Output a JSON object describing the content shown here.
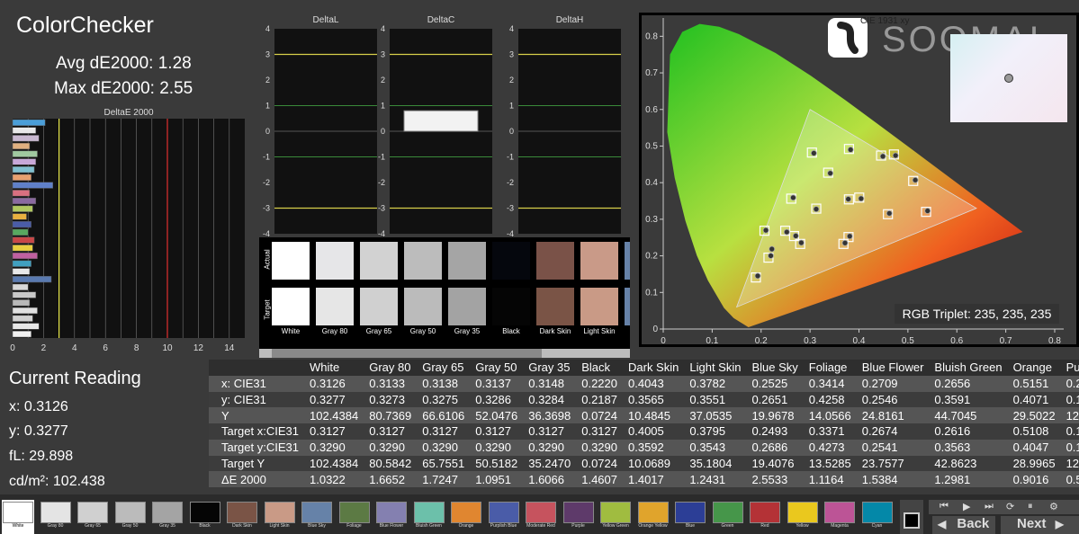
{
  "app": {
    "title": "ColorChecker",
    "avg_label": "Avg dE2000: 1.28",
    "max_label": "Max dE2000: 2.55",
    "watermark": "SOOMAL"
  },
  "deltae_chart": {
    "title": "DeltaE 2000",
    "ticks": [
      "0",
      "2",
      "4",
      "6",
      "8",
      "10",
      "12",
      "14"
    ],
    "xlim": [
      0,
      15
    ],
    "thresholds": [
      {
        "value": 3,
        "color": "#e6e64a"
      },
      {
        "value": 10,
        "color": "#e03030"
      }
    ],
    "values": [
      2.1,
      1.5,
      1.7,
      1.1,
      1.6,
      1.5,
      1.4,
      1.2,
      2.6,
      1.1,
      1.5,
      1.3,
      0.9,
      1.2,
      1.0,
      1.4,
      1.3,
      1.6,
      1.2,
      1.1,
      2.5,
      1.0,
      1.5,
      1.1,
      1.6,
      1.3,
      1.7,
      1.2
    ]
  },
  "delta_charts": [
    {
      "title": "DeltaL",
      "yticks": [
        "4",
        "3",
        "2",
        "1",
        "0",
        "-1",
        "-2",
        "-3",
        "-4"
      ],
      "value": 0
    },
    {
      "title": "DeltaC",
      "yticks": [
        "4",
        "3",
        "2",
        "1",
        "0",
        "-1",
        "-2",
        "-3",
        "-4"
      ],
      "value": 0.8
    },
    {
      "title": "DeltaH",
      "yticks": [
        "4",
        "3",
        "2",
        "1",
        "0",
        "-1",
        "-2",
        "-3",
        "-4"
      ],
      "value": 0
    }
  ],
  "swatch_strip": {
    "row_labels": {
      "actual": "Actual",
      "target": "Target"
    },
    "patches": [
      {
        "name": "White",
        "actual": "#ffffff",
        "target": "#ffffff"
      },
      {
        "name": "Gray 80",
        "actual": "#e6e6e8",
        "target": "#e6e6e6"
      },
      {
        "name": "Gray 65",
        "actual": "#d2d2d2",
        "target": "#d0d0d0"
      },
      {
        "name": "Gray 50",
        "actual": "#bcbcbc",
        "target": "#bbbbbb"
      },
      {
        "name": "Gray 35",
        "actual": "#a5a5a5",
        "target": "#a3a3a3"
      },
      {
        "name": "Black",
        "actual": "#05070d",
        "target": "#050505"
      },
      {
        "name": "Dark Skin",
        "actual": "#7a5248",
        "target": "#7a5446"
      },
      {
        "name": "Light Skin",
        "actual": "#c99a88",
        "target": "#c99a86"
      },
      {
        "name": "B",
        "actual": "#6682a8",
        "target": "#6682a8"
      }
    ]
  },
  "cie_chart": {
    "label": "CIE 1931 xy",
    "xticks": [
      "0",
      "0.1",
      "0.2",
      "0.3",
      "0.4",
      "0.5",
      "0.6",
      "0.7",
      "0.8"
    ],
    "yticks": [
      "0.8",
      "0.7",
      "0.6",
      "0.5",
      "0.4",
      "0.3",
      "0.2",
      "0.1",
      "0"
    ],
    "xlim": [
      0,
      0.8
    ],
    "ylim": [
      0,
      0.85
    ],
    "rgb_triplet": "RGB Triplet: 235, 235, 235",
    "targets": [
      [
        0.3127,
        0.329
      ],
      [
        0.4005,
        0.3592
      ],
      [
        0.3795,
        0.3543
      ],
      [
        0.2493,
        0.2686
      ],
      [
        0.3371,
        0.4273
      ],
      [
        0.2674,
        0.2541
      ],
      [
        0.2616,
        0.3563
      ],
      [
        0.5108,
        0.4047
      ],
      [
        0.2151,
        0.1951
      ],
      [
        0.4592,
        0.3138
      ],
      [
        0.3787,
        0.2514
      ],
      [
        0.3796,
        0.4921
      ],
      [
        0.4714,
        0.4771
      ],
      [
        0.1893,
        0.1409
      ],
      [
        0.3039,
        0.4822
      ],
      [
        0.5371,
        0.3202
      ],
      [
        0.4452,
        0.4741
      ],
      [
        0.3683,
        0.2327
      ],
      [
        0.2069,
        0.2686
      ],
      [
        0.2798,
        0.2326
      ]
    ],
    "actuals": [
      [
        0.3126,
        0.3277
      ],
      [
        0.4043,
        0.3565
      ],
      [
        0.3782,
        0.3551
      ],
      [
        0.2525,
        0.2651
      ],
      [
        0.3414,
        0.4258
      ],
      [
        0.2709,
        0.2546
      ],
      [
        0.2656,
        0.3591
      ],
      [
        0.5151,
        0.4071
      ],
      [
        0.2198,
        0.2003
      ],
      [
        0.4621,
        0.3162
      ],
      [
        0.3811,
        0.2537
      ],
      [
        0.3829,
        0.4901
      ],
      [
        0.4748,
        0.4742
      ],
      [
        0.1931,
        0.1452
      ],
      [
        0.3078,
        0.4806
      ],
      [
        0.5402,
        0.3231
      ],
      [
        0.4489,
        0.4719
      ],
      [
        0.3715,
        0.2352
      ],
      [
        0.2098,
        0.2699
      ],
      [
        0.2821,
        0.2358
      ],
      [
        0.222,
        0.2187
      ]
    ]
  },
  "current_reading": {
    "title": "Current Reading",
    "x": "x: 0.3126",
    "y": "y: 0.3277",
    "fl": "fL: 29.898",
    "cd": "cd/m²: 102.438"
  },
  "table": {
    "columns": [
      "",
      "White",
      "Gray 80",
      "Gray 65",
      "Gray 50",
      "Gray 35",
      "Black",
      "Dark Skin",
      "Light Skin",
      "Blue Sky",
      "Foliage",
      "Blue Flower",
      "Bluish Green",
      "Orange",
      "Pur"
    ],
    "rows": [
      [
        "x: CIE31",
        "0.3126",
        "0.3133",
        "0.3138",
        "0.3137",
        "0.3148",
        "0.2220",
        "0.4043",
        "0.3782",
        "0.2525",
        "0.3414",
        "0.2709",
        "0.2656",
        "0.5151",
        "0.2"
      ],
      [
        "y: CIE31",
        "0.3277",
        "0.3273",
        "0.3275",
        "0.3286",
        "0.3284",
        "0.2187",
        "0.3565",
        "0.3551",
        "0.2651",
        "0.4258",
        "0.2546",
        "0.3591",
        "0.4071",
        "0.1"
      ],
      [
        "Y",
        "102.4384",
        "80.7369",
        "66.6106",
        "52.0476",
        "36.3698",
        "0.0724",
        "10.4845",
        "37.0535",
        "19.9678",
        "14.0566",
        "24.8161",
        "44.7045",
        "29.5022",
        "12."
      ],
      [
        "Target x:CIE31",
        "0.3127",
        "0.3127",
        "0.3127",
        "0.3127",
        "0.3127",
        "0.3127",
        "0.4005",
        "0.3795",
        "0.2493",
        "0.3371",
        "0.2674",
        "0.2616",
        "0.5108",
        "0.1"
      ],
      [
        "Target y:CIE31",
        "0.3290",
        "0.3290",
        "0.3290",
        "0.3290",
        "0.3290",
        "0.3290",
        "0.3592",
        "0.3543",
        "0.2686",
        "0.4273",
        "0.2541",
        "0.3563",
        "0.4047",
        "0.1"
      ],
      [
        "Target Y",
        "102.4384",
        "80.5842",
        "65.7551",
        "50.5182",
        "35.2470",
        "0.0724",
        "10.0689",
        "35.1804",
        "19.4076",
        "13.5285",
        "23.7577",
        "42.8623",
        "28.9965",
        "12."
      ],
      [
        "ΔE 2000",
        "1.0322",
        "1.6652",
        "1.7247",
        "1.0951",
        "1.6066",
        "1.4607",
        "1.4017",
        "1.2431",
        "2.5533",
        "1.1164",
        "1.5384",
        "1.2981",
        "0.9016",
        "0.5"
      ]
    ]
  },
  "patch_bar": [
    {
      "label": "White",
      "color": "#ffffff"
    },
    {
      "label": "Gray 80",
      "color": "#e4e4e4"
    },
    {
      "label": "Gray 65",
      "color": "#d0d0d0"
    },
    {
      "label": "Gray 50",
      "color": "#bbbbbb"
    },
    {
      "label": "Gray 35",
      "color": "#a4a4a4"
    },
    {
      "label": "Black",
      "color": "#050505"
    },
    {
      "label": "Dark Skin",
      "color": "#7a5446"
    },
    {
      "label": "Light Skin",
      "color": "#c99a86"
    },
    {
      "label": "Blue Sky",
      "color": "#6682a8"
    },
    {
      "label": "Foliage",
      "color": "#5c7a44"
    },
    {
      "label": "Blue Flower",
      "color": "#8480b0"
    },
    {
      "label": "Bluish Green",
      "color": "#6cc0aa"
    },
    {
      "label": "Orange",
      "color": "#e08630"
    },
    {
      "label": "Purplish Blue",
      "color": "#4a5ca8"
    },
    {
      "label": "Moderate Red",
      "color": "#c6535e"
    },
    {
      "label": "Purple",
      "color": "#5e3a6a"
    },
    {
      "label": "Yellow Green",
      "color": "#a0bc40"
    },
    {
      "label": "Orange Yellow",
      "color": "#e0a42c"
    },
    {
      "label": "Blue",
      "color": "#2c3e96"
    },
    {
      "label": "Green",
      "color": "#46964a"
    },
    {
      "label": "Red",
      "color": "#b43236"
    },
    {
      "label": "Yellow",
      "color": "#eac81e"
    },
    {
      "label": "Magenta",
      "color": "#bc5496"
    },
    {
      "label": "Cyan",
      "color": "#0488a8"
    }
  ],
  "nav": {
    "back": "Back",
    "next": "Next"
  }
}
